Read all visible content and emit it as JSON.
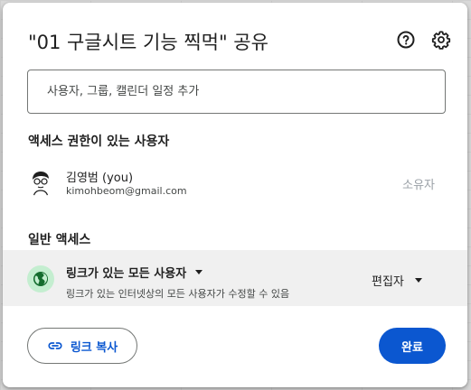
{
  "dialog": {
    "title": "\"01 구글시트 기능 찍먹\" 공유",
    "icons": {
      "help": "help-circle-icon",
      "settings": "gear-icon"
    }
  },
  "add_people": {
    "placeholder": "사용자, 그룹, 캘린더 일정 추가"
  },
  "people_with_access": {
    "heading": "액세스 권한이 있는 사용자",
    "users": [
      {
        "name": "김영범 (you)",
        "email": "kimohbeom@gmail.com",
        "role": "소유자"
      }
    ]
  },
  "general_access": {
    "heading": "일반 액세스",
    "scope": "링크가 있는 모든 사용자",
    "description": "링크가 있는 인터넷상의 모든 사용자가 수정할 수 있음",
    "role": "편집자",
    "icon": "globe-icon"
  },
  "footer": {
    "copy_link_label": "링크 복사",
    "done_label": "완료"
  },
  "colors": {
    "primary": "#0b57d0",
    "globe_bg": "#c4eed0",
    "globe_fg": "#146c2e"
  }
}
